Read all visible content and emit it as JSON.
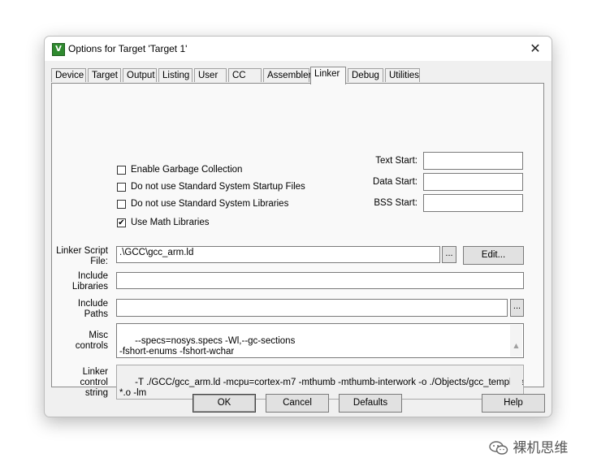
{
  "window": {
    "title": "Options for Target 'Target 1'",
    "app_icon": "keil-uvision-icon",
    "close_glyph": "✕"
  },
  "tabs": [
    {
      "label": "Device"
    },
    {
      "label": "Target"
    },
    {
      "label": "Output"
    },
    {
      "label": "Listing"
    },
    {
      "label": "User"
    },
    {
      "label": "CC"
    },
    {
      "label": "Assembler"
    },
    {
      "label": "Linker",
      "active": true
    },
    {
      "label": "Debug"
    },
    {
      "label": "Utilities"
    }
  ],
  "options": {
    "enable_gc": {
      "label": "Enable Garbage Collection",
      "checked": false
    },
    "no_startup": {
      "label": "Do not use Standard System Startup Files",
      "checked": false
    },
    "no_stdlib": {
      "label": "Do not use Standard System Libraries",
      "checked": false
    },
    "use_math": {
      "label": "Use Math Libraries",
      "checked": true,
      "mark": "✔"
    }
  },
  "addresses": {
    "text_start": {
      "label": "Text Start:",
      "value": ""
    },
    "data_start": {
      "label": "Data Start:",
      "value": ""
    },
    "bss_start": {
      "label": "BSS Start:",
      "value": ""
    }
  },
  "linker_script": {
    "label_line1": "Linker Script",
    "label_line2": "File:",
    "value": ".\\GCC\\gcc_arm.ld",
    "browse_label": "...",
    "edit_label": "Edit..."
  },
  "include_libraries": {
    "label_line1": "Include",
    "label_line2": "Libraries",
    "value": ""
  },
  "include_paths": {
    "label_line1": "Include",
    "label_line2": "Paths",
    "value": "",
    "browse_label": "..."
  },
  "misc_controls": {
    "label_line1": "Misc",
    "label_line2": "controls",
    "value": "--specs=nosys.specs -Wl,--gc-sections\n-fshort-enums -fshort-wchar"
  },
  "linker_control": {
    "label_line1": "Linker",
    "label_line2": "control",
    "label_line3": "string",
    "value": "-T ./GCC/gcc_arm.ld -mcpu=cortex-m7 -mthumb -mthumb-interwork -o ./Objects/gcc_template.elf\n*.o -lm"
  },
  "buttons": {
    "ok": "OK",
    "cancel": "Cancel",
    "defaults": "Defaults",
    "help": "Help"
  },
  "watermark": {
    "text": "裸机思维",
    "icon": "wechat-icon"
  }
}
